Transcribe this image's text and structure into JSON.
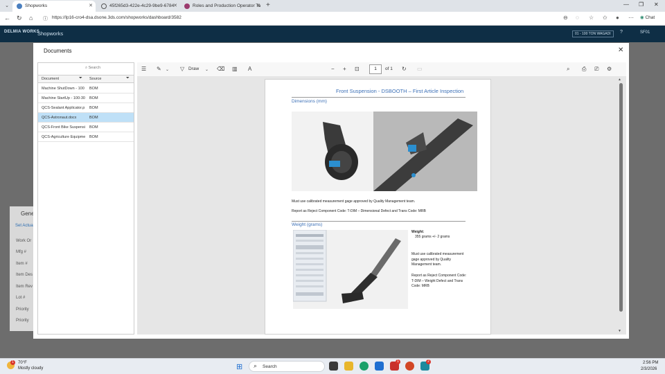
{
  "browser": {
    "tabs": [
      {
        "title": "Shopworks",
        "active": true
      },
      {
        "title": "45f265d3-422e-4c29-9be9-6784",
        "active": false
      },
      {
        "title": "Roles and Production Operator Ta",
        "active": false
      }
    ],
    "url": "https://lp16-cro4-dsa.dsone.3ds.com/shopworks/dashboard/3582",
    "chat_label": "Chat"
  },
  "app": {
    "logo": "DELMIA WORKS",
    "name": "Shopworks",
    "resource_button": "01 - 100 TON WAGADI",
    "user": "SF01",
    "bg_panel": {
      "title": "Gene",
      "link": "Set Actua",
      "fields": [
        "Work Or",
        "Mfg #",
        "Item #",
        "Item Des",
        "Item Rev",
        "Lot #",
        "Priority",
        "Priority"
      ]
    }
  },
  "modal": {
    "title": "Documents",
    "search_placeholder": "Search",
    "columns": {
      "document": "Document",
      "source": "Source"
    },
    "documents": [
      {
        "name": "Machine ShutDown - 100",
        "source": "BOM",
        "selected": false
      },
      {
        "name": "Machine StartUp - 100-30",
        "source": "BOM",
        "selected": false
      },
      {
        "name": "QCS-Sealant Applicator.p",
        "source": "BOM",
        "selected": false
      },
      {
        "name": "QCS-Astronaut.docx",
        "source": "BOM",
        "selected": true
      },
      {
        "name": "QCS-Front Bike Suspensi",
        "source": "BOM",
        "selected": false
      },
      {
        "name": "QCS-Agriculture Equipme",
        "source": "BOM",
        "selected": false
      }
    ]
  },
  "viewer": {
    "draw_label": "Draw",
    "page_current": "1",
    "page_of": "of 1",
    "document": {
      "title": "Front Suspension - DSBOOTH – First Article Inspection",
      "section1": "Dimensions (mm)",
      "note1": "Must use calibrated measurement gage approved by Quality Management team.",
      "reject1": "Report as Reject Component Code: T-DIM – Dimensional Defect and Trans Code: MRB",
      "section2": "Weight (grams)",
      "weight_label": "Weight:",
      "weight_value": "355 grams +/- 2 grams",
      "note2": "Must use calibrated measurement gage approved by Quality Management team.",
      "reject2": "Report as Reject Component Code: T-DIM – Weight Defect and Trans Code: MRB"
    }
  },
  "taskbar": {
    "weather_temp": "70°F",
    "weather_desc": "Mostly cloudy",
    "weather_badge": "1",
    "search_label": "Search",
    "time": "2:56 PM",
    "date": "2/3/2026",
    "badge_a": "1",
    "badge_b": "2"
  },
  "colors": {
    "accent_blue": "#3b6fb6",
    "selected_row": "#bfe0f7",
    "app_bar": "#0e2e45"
  }
}
